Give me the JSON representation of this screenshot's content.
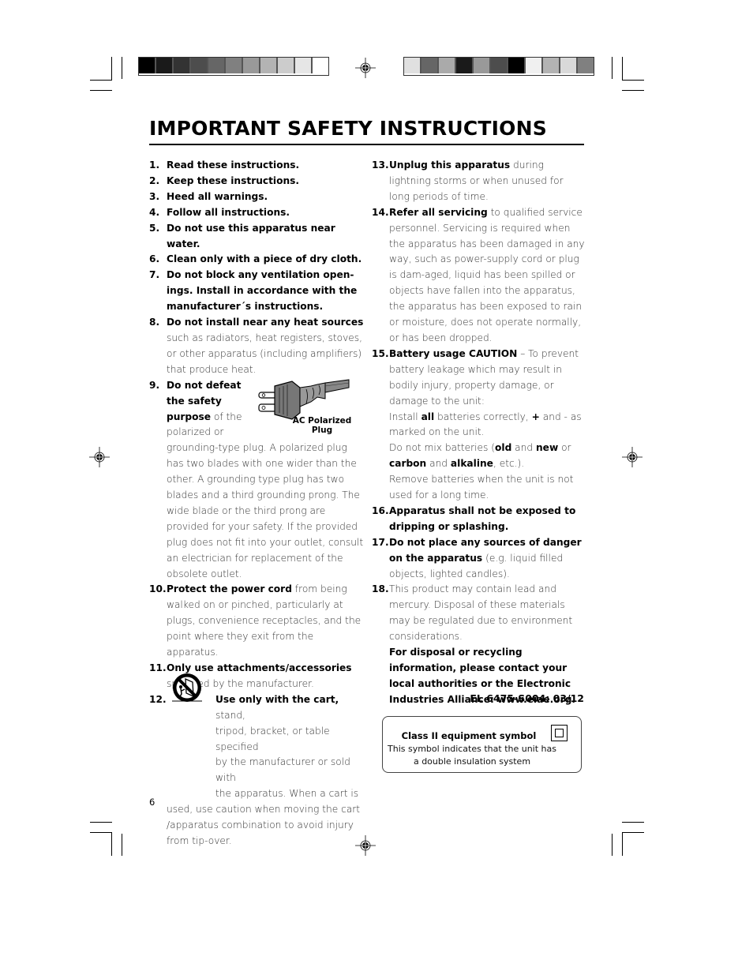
{
  "page": {
    "title": "IMPORTANT SAFETY INSTRUCTIONS",
    "page_number": "6",
    "reference_code": "EL 6475-S004: 03/12",
    "color_bars": {
      "left": [
        "#000000",
        "#1a1a1a",
        "#333333",
        "#4d4d4d",
        "#666666",
        "#808080",
        "#999999",
        "#b3b3b3",
        "#cccccc",
        "#e6e6e6",
        "#ffffff"
      ],
      "right": [
        "#e0e0e0",
        "#666666",
        "#aaaaaa",
        "#1a1a1a",
        "#999999",
        "#4d4d4d",
        "#000000",
        "#f0f0f0",
        "#b3b3b3",
        "#d9d9d9",
        "#808080"
      ]
    }
  },
  "left_column": [
    {
      "num": "1.",
      "bold": "Read these instructions.",
      "text": ""
    },
    {
      "num": "2.",
      "bold": "Keep these instructions.",
      "text": ""
    },
    {
      "num": "3.",
      "bold": "Heed all warnings.",
      "text": ""
    },
    {
      "num": "4.",
      "bold": "Follow all instructions.",
      "text": ""
    },
    {
      "num": "5.",
      "bold": "Do not use this apparatus near water.",
      "text": ""
    },
    {
      "num": "6.",
      "bold": "Clean only with a piece of dry cloth.",
      "text": ""
    },
    {
      "num": "7.",
      "bold": "Do not block any ventilation open-ings. Install in accordance with the manufacturer´s instructions.",
      "text": ""
    },
    {
      "num": "8.",
      "bold": "Do not install near any heat sources",
      "text": "such as radiators, heat registers, stoves, or other apparatus (including amplifiers) that produce heat."
    },
    {
      "num": "9.",
      "bold_lines": [
        "Do not defeat",
        "the safety",
        "purpose"
      ],
      "text_after_bold": " of the",
      "text_line": "polarized or",
      "text": "grounding-type plug. A polarized plug has two blades with one wider than the other. A grounding type plug has two blades and a third grounding prong. The wide blade or the third prong are provided for your safety. If the provided plug does not fit into your outlet, consult an electrician for replacement of the obsolete outlet."
    },
    {
      "num": "10.",
      "bold": "Protect the power cord",
      "text": " from being walked on or pinched, particularly at plugs, convenience receptacles, and the point where they exit from the apparatus."
    },
    {
      "num": "11.",
      "bold": "Only use attachments/accessories",
      "text": "specified by the manufacturer."
    },
    {
      "num": "12.",
      "bold": "Use only with the cart,",
      "text_lines": [
        " stand,",
        "tripod, bracket, or table specified",
        "by the manufacturer or sold with",
        "the apparatus. When a cart is"
      ],
      "text": "used, use caution when moving the cart /apparatus combination to avoid injury from tip-over."
    }
  ],
  "right_column": [
    {
      "num": "13.",
      "bold": "Unplug this apparatus",
      "text": " during lightning storms or when unused for long periods of time."
    },
    {
      "num": "14.",
      "bold": "Refer all servicing",
      "text": " to qualified service personnel. Servicing is required when the apparatus has been damaged in any way, such as power-supply cord or plug is dam-aged, liquid has been spilled or objects have fallen into the apparatus, the apparatus has been exposed to rain or moisture, does not operate normally, or has been dropped."
    },
    {
      "num": "15.",
      "bold": "Battery usage CAUTION",
      "text": " – To prevent battery leakage which may result in bodily injury, property damage, or damage to the unit:",
      "sub": {
        "install_pre": "Install ",
        "install_bold": "all",
        "install_mid": " batteries correctly, ",
        "install_plus": "+",
        "install_post": " and - as marked on the unit.",
        "mix_pre": "Do not mix batteries (",
        "mix_old": "old",
        "mix_and1": " and ",
        "mix_new": "new",
        "mix_or": " or ",
        "mix_carbon": "carbon",
        "mix_and2": " and ",
        "mix_alkaline": "alkaline",
        "mix_post": ", etc.).",
        "remove": "Remove batteries when the unit is not used for a long time."
      }
    },
    {
      "num": "16.",
      "bold": "Apparatus shall not be exposed to dripping or splashing.",
      "text": ""
    },
    {
      "num": "17.",
      "bold": "Do not place any sources of danger on the apparatus",
      "text": " (e.g. liquid filled objects, lighted candles)."
    },
    {
      "num": "18.",
      "text": "This product may contain lead and mercury. Disposal of these materials may be regulated due to environment considerations.",
      "bold_after": "For disposal or recycling information, please contact your local authorities or the Electronic Industries Alliance: www.eiae.org."
    }
  ],
  "figures": {
    "plug_label_line1": "AC Polarized",
    "plug_label_line2": "Plug",
    "plug_icon": "ac-polarized-plug-icon",
    "cart_icon": "cart-tip-over-warning-icon"
  },
  "class2_box": {
    "title": "Class II equipment symbol",
    "text_line1": "This symbol indicates that the unit has",
    "text_line2": "a double insulation system",
    "icon": "class-ii-double-square-icon"
  }
}
